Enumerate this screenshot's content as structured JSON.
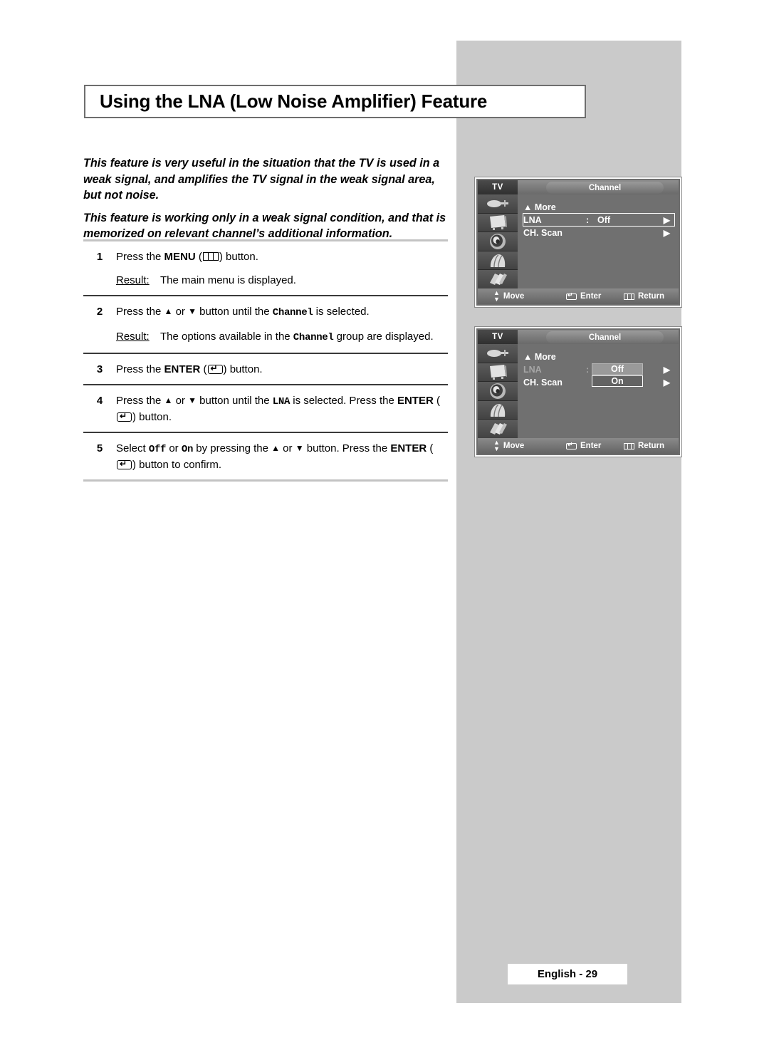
{
  "document": {
    "title": "Using the LNA (Low Noise Amplifier) Feature",
    "page_label": "English - 29"
  },
  "intro": {
    "paragraph_1": "This feature is very useful in the situation that the TV is used in a weak signal, and amplifies the TV signal in the weak signal area, but not noise.",
    "paragraph_2": "This feature is working only in a weak signal condition, and that is memorized on relevant channel’s additional information."
  },
  "steps": [
    {
      "number": "1",
      "text_a": "Press the ",
      "bold_a": "MENU",
      "text_b": " (",
      "icon": "menu-icon",
      "text_c": ") button.",
      "result_label": "Result:",
      "result_text": "The main menu is displayed."
    },
    {
      "number": "2",
      "text_a": "Press the ",
      "up": "▲",
      "or": " or ",
      "down": "▼",
      "text_b": " button until the ",
      "mono": "Channel",
      "text_c": " is selected.",
      "result_label": "Result:",
      "result_text_a": "The options available in the ",
      "result_mono": "Channel",
      "result_text_b": " group are displayed."
    },
    {
      "number": "3",
      "text_a": "Press the ",
      "bold_a": "ENTER",
      "text_b": " (",
      "icon": "enter-icon",
      "text_c": ") button."
    },
    {
      "number": "4",
      "text_a": "Press the ",
      "up": "▲",
      "or": " or ",
      "down": "▼",
      "text_b": " button until the ",
      "mono": "LNA",
      "text_c": " is selected. Press the ",
      "bold_b": "ENTER",
      "text_d": " (",
      "icon": "enter-icon",
      "text_e": ") button."
    },
    {
      "number": "5",
      "text_a": "Select ",
      "mono_a": "Off",
      "text_b": " or ",
      "mono_b": "On",
      "text_c": "  by pressing the ",
      "up": "▲",
      "or": " or ",
      "down": "▼",
      "text_d": " button. Press the ",
      "bold_b": "ENTER",
      "text_e": " (",
      "icon": "enter-icon",
      "text_f": ") button to confirm."
    }
  ],
  "osd_menus": [
    {
      "id": "menu-lna-off",
      "source_label": "TV",
      "tab_label": "Channel",
      "rows": [
        {
          "label": "▲ More",
          "colon": "",
          "value": "",
          "arrow": "",
          "selected": false
        },
        {
          "label": "LNA",
          "colon": ":",
          "value": "Off",
          "arrow": "▶",
          "selected": true
        },
        {
          "label": "CH. Scan",
          "colon": "",
          "value": "",
          "arrow": "▶",
          "selected": false
        }
      ],
      "footer": {
        "move": "Move",
        "enter": "Enter",
        "return": "Return"
      }
    },
    {
      "id": "menu-lna-options",
      "source_label": "TV",
      "tab_label": "Channel",
      "rows": [
        {
          "label": "▲ More",
          "colon": "",
          "value": "",
          "arrow": "",
          "selected": false,
          "dim": false
        },
        {
          "label": "LNA",
          "colon": ":",
          "value": "",
          "arrow": "▶",
          "selected": false,
          "dim": true
        },
        {
          "label": "CH. Scan",
          "colon": "",
          "value": "",
          "arrow": "▶",
          "selected": false,
          "dim": false
        }
      ],
      "options": [
        {
          "label": "Off",
          "state": "highlighted"
        },
        {
          "label": "On",
          "state": "focused"
        }
      ],
      "footer": {
        "move": "Move",
        "enter": "Enter",
        "return": "Return"
      }
    }
  ],
  "colors": {
    "panel_gray": "#cacaca",
    "osd_body": "#707070",
    "osd_sidebar": "#4f4f4f",
    "rule_light": "#c3c3c3",
    "rule_dark": "#3a3a3a"
  }
}
